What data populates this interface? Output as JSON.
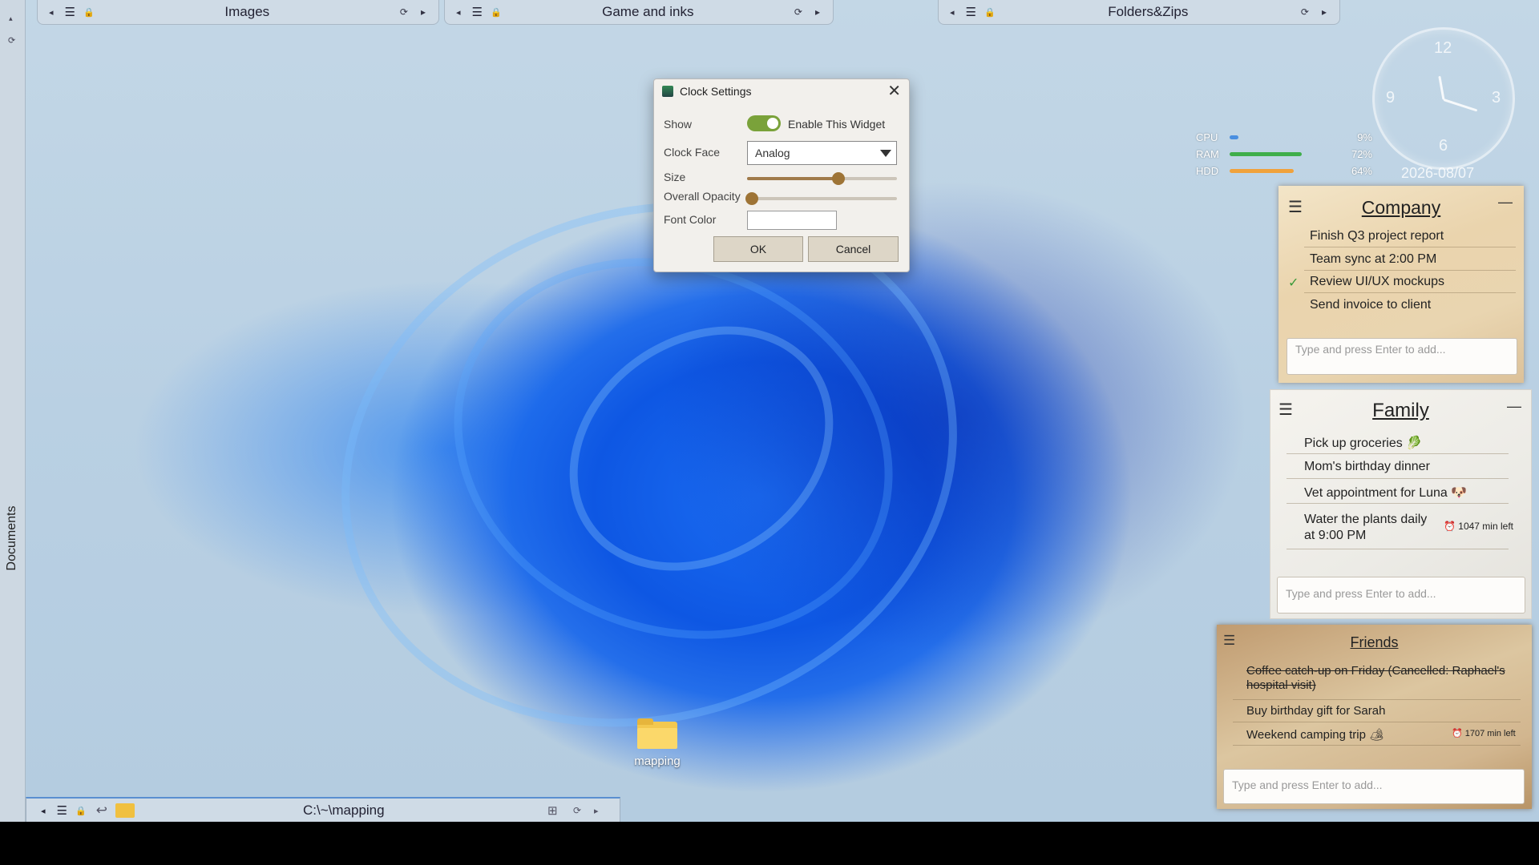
{
  "sidebar_left": {
    "label": "Documents"
  },
  "fences": [
    {
      "title": "Images"
    },
    {
      "title": "Game and inks"
    },
    {
      "title": "Folders&Zips"
    }
  ],
  "icons": {
    "prev": "◂",
    "next": "▸",
    "menu": "☰",
    "lock": "🔒",
    "refresh": "⟳",
    "close": "✕",
    "check": "✓",
    "undo": "↩",
    "grid": "⊞"
  },
  "system_monitor": {
    "cpu": {
      "label": "CPU",
      "value": "9%",
      "percent": 9,
      "color": "#4a8fe0"
    },
    "ram": {
      "label": "RAM",
      "value": "72%",
      "percent": 72,
      "color": "#3fae4a"
    },
    "hdd": {
      "label": "HDD",
      "value": "64%",
      "percent": 64,
      "color": "#f0a23c"
    }
  },
  "clock": {
    "n12": "12",
    "n3": "3",
    "n6": "6",
    "n9": "9",
    "date": "2026-08/07"
  },
  "dialog": {
    "title": "Clock Settings",
    "show_label": "Show",
    "enable_label": "Enable This Widget",
    "enabled": true,
    "clock_face_label": "Clock Face",
    "clock_face_value": "Analog",
    "size_label": "Size",
    "size_value": 0.61,
    "opacity_label": "Overall Opacity",
    "opacity_value": 0.03,
    "font_color_label": "Font Color",
    "ok": "OK",
    "cancel": "Cancel"
  },
  "notes": {
    "company": {
      "title": "Company",
      "items": [
        {
          "text": "Finish Q3 project report",
          "done": false
        },
        {
          "text": "Team sync at 2:00 PM",
          "done": false
        },
        {
          "text": "Review UI/UX mockups",
          "done": true
        },
        {
          "text": "Send invoice to client",
          "done": false
        }
      ],
      "placeholder": "Type and press Enter to add..."
    },
    "family": {
      "title": "Family",
      "items": [
        {
          "text": "Pick up groceries 🥬"
        },
        {
          "text": "Mom's birthday dinner"
        },
        {
          "text": "Vet appointment for Luna 🐶"
        },
        {
          "text": "Water the plants daily at 9:00 PM",
          "timer": "⏰ 1047 min left"
        }
      ],
      "placeholder": "Type and press Enter to add..."
    },
    "friends": {
      "title": "Friends",
      "items": [
        {
          "text": "Coffee catch-up on Friday (Cancelled: Raphael's hospital visit)",
          "struck": true
        },
        {
          "text": "Buy birthday gift for Sarah"
        },
        {
          "text": "Weekend camping trip 🏕",
          "timer": "⏰ 1707 min left"
        }
      ],
      "placeholder": "Type and press Enter to add..."
    }
  },
  "bottom_fence": {
    "path": "C:\\~\\mapping"
  },
  "desktop_folder": {
    "label": "mapping"
  }
}
